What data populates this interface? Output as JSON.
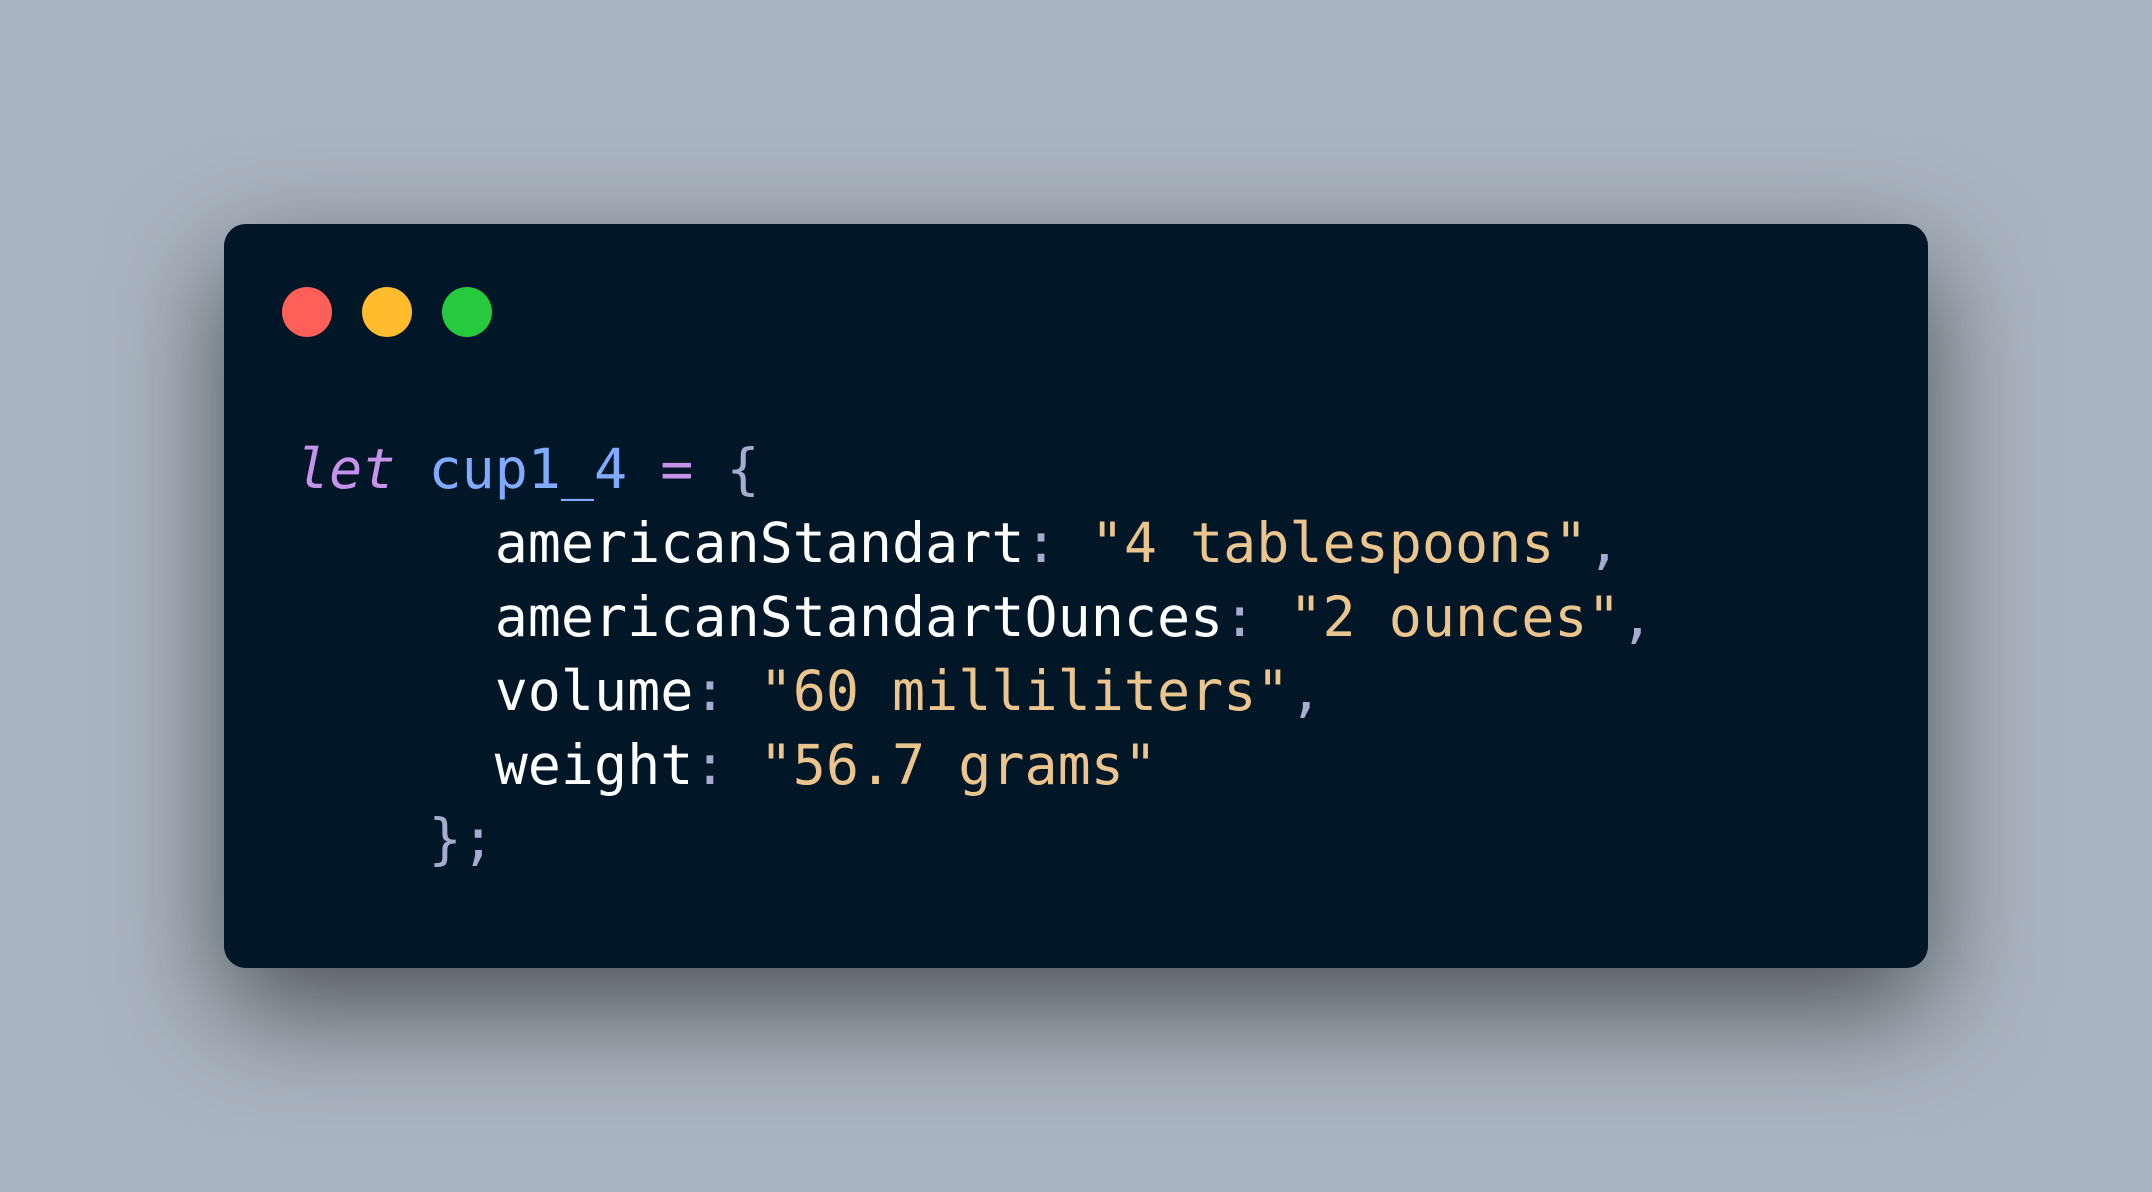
{
  "window": {
    "controls": [
      "close",
      "minimize",
      "maximize"
    ],
    "colors": {
      "background": "#011627",
      "page_background": "#a8b4bf",
      "close": "#ff5f56",
      "minimize": "#ffbd2e",
      "maximize": "#27c93f"
    }
  },
  "code": {
    "keyword": "let",
    "variable": "cup1_4",
    "assign": "=",
    "open_brace": "{",
    "properties": [
      {
        "key": "americanStandart",
        "value": "\"4 tablespoons\"",
        "separator": ","
      },
      {
        "key": "americanStandartOunces",
        "value": "\"2 ounces\"",
        "separator": ","
      },
      {
        "key": "volume",
        "value": "\"60 milliliters\"",
        "separator": ","
      },
      {
        "key": "weight",
        "value": "\"56.7 grams\"",
        "separator": ""
      }
    ],
    "close": "};"
  },
  "syntax_colors": {
    "keyword": "#c792ea",
    "variable": "#82aaff",
    "key": "#ffffff",
    "string": "#ecc48d",
    "punctuation": "#a6accd"
  }
}
